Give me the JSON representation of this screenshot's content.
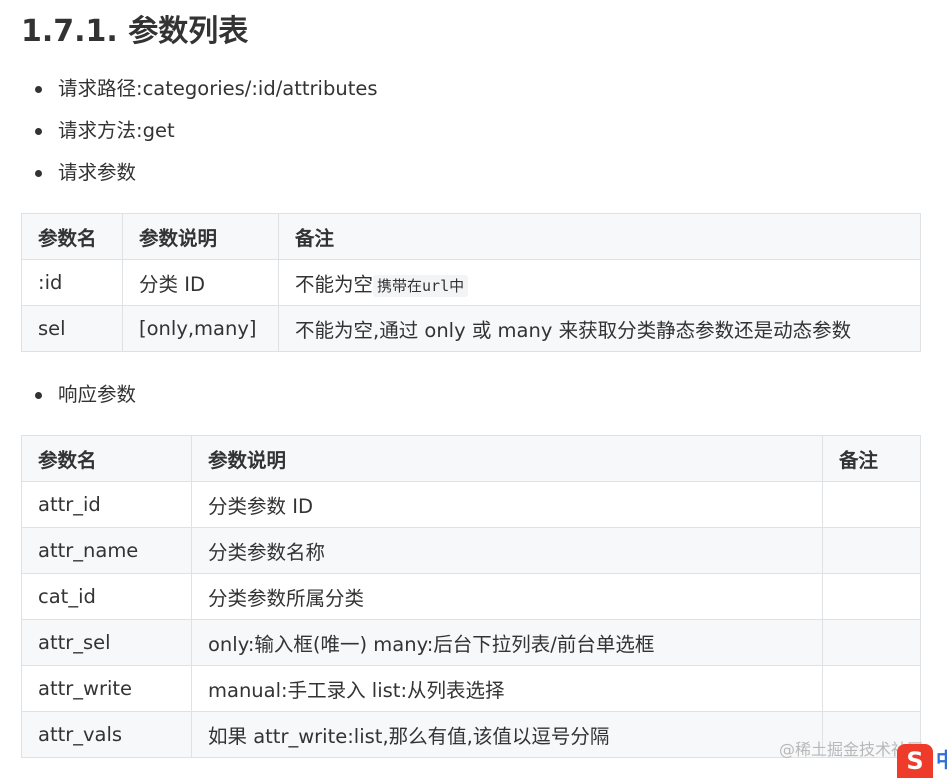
{
  "title": "1.7.1. 参数列表",
  "bullets": {
    "path_label": "请求路径:",
    "path_value": "categories/:id/attributes",
    "method_label": "请求方法:",
    "method_value": "get",
    "params": "请求参数",
    "response": "响应参数"
  },
  "request_table": {
    "headers": [
      "参数名",
      "参数说明",
      "备注"
    ],
    "rows": [
      [
        ":id",
        "分类 ID",
        "不能为空",
        "携带在",
        "url",
        "中"
      ],
      [
        "sel",
        "[only,many]",
        "不能为空,通过 only 或 many 来获取分类静态参数还是动态参数"
      ]
    ]
  },
  "response_table": {
    "headers": [
      "参数名",
      "参数说明",
      "备注"
    ],
    "rows": [
      [
        "attr_id",
        "分类参数 ID",
        ""
      ],
      [
        "attr_name",
        "分类参数名称",
        ""
      ],
      [
        "cat_id",
        "分类参数所属分类",
        ""
      ],
      [
        "attr_sel",
        "only:输入框(唯一) many:后台下拉列表/前台单选框",
        ""
      ],
      [
        "attr_write",
        "manual:手工录入 list:从列表选择",
        ""
      ],
      [
        "attr_vals",
        "如果 attr_write:list,那么有值,该值以逗号分隔",
        ""
      ]
    ]
  },
  "watermark": {
    "text": "@稀土掘金技术社区",
    "logo_glyph": "S",
    "tail_glyph": "中"
  },
  "colors": {
    "text": "#333333",
    "border": "#dfe2e5",
    "header_bg": "#f6f8fa",
    "watermark_logo": "#ef3c2a"
  }
}
